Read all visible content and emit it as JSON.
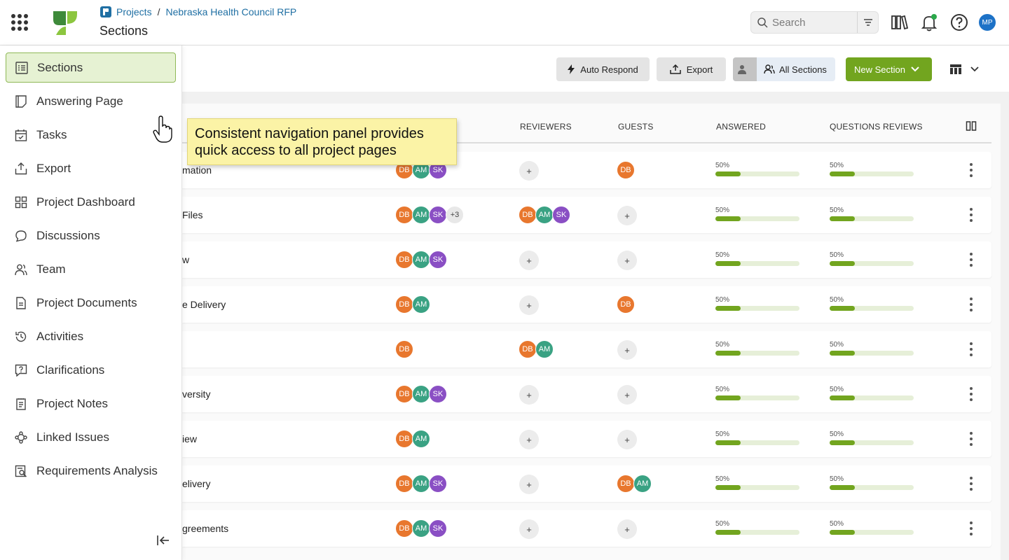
{
  "topbar": {
    "breadcrumb_projects": "Projects",
    "breadcrumb_separator": "/",
    "breadcrumb_project": "Nebraska Health Council RFP",
    "title": "Sections",
    "search_placeholder": "Search",
    "user_initials": "MP"
  },
  "toolbar": {
    "auto_respond": "Auto Respond",
    "export": "Export",
    "all_sections": "All Sections",
    "new_section": "New Section"
  },
  "table": {
    "headers": [
      "REVIEWERS",
      "GUESTS",
      "ANSWERED",
      "QUESTIONS REVIEWS"
    ],
    "rows": [
      {
        "name": "mation",
        "assignees": [
          "DB",
          "AM",
          "SK"
        ],
        "more": "",
        "reviewers": [],
        "guests": [
          "DB"
        ],
        "answered_pct": "50%",
        "answered": 0.3,
        "reviews_pct": "50%",
        "reviews": 0.3
      },
      {
        "name": "Files",
        "assignees": [
          "DB",
          "AM",
          "SK"
        ],
        "more": "+3",
        "reviewers": [
          "DB",
          "AM",
          "SK"
        ],
        "guests": [],
        "answered_pct": "50%",
        "answered": 0.3,
        "reviews_pct": "50%",
        "reviews": 0.3
      },
      {
        "name": "w",
        "assignees": [
          "DB",
          "AM",
          "SK"
        ],
        "more": "",
        "reviewers": [],
        "guests": [],
        "answered_pct": "50%",
        "answered": 0.3,
        "reviews_pct": "50%",
        "reviews": 0.3
      },
      {
        "name": "e Delivery",
        "assignees": [
          "DB",
          "AM"
        ],
        "more": "",
        "reviewers": [],
        "guests": [
          "DB"
        ],
        "answered_pct": "50%",
        "answered": 0.3,
        "reviews_pct": "50%",
        "reviews": 0.3
      },
      {
        "name": "",
        "assignees": [
          "DB"
        ],
        "more": "",
        "reviewers": [
          "DB",
          "AM"
        ],
        "guests": [],
        "answered_pct": "50%",
        "answered": 0.3,
        "reviews_pct": "50%",
        "reviews": 0.3
      },
      {
        "name": "versity",
        "assignees": [
          "DB",
          "AM",
          "SK"
        ],
        "more": "",
        "reviewers": [],
        "guests": [],
        "answered_pct": "50%",
        "answered": 0.3,
        "reviews_pct": "50%",
        "reviews": 0.3
      },
      {
        "name": "iew",
        "assignees": [
          "DB",
          "AM"
        ],
        "more": "",
        "reviewers": [],
        "guests": [],
        "answered_pct": "50%",
        "answered": 0.3,
        "reviews_pct": "50%",
        "reviews": 0.3
      },
      {
        "name": "elivery",
        "assignees": [
          "DB",
          "AM",
          "SK"
        ],
        "more": "",
        "reviewers": [],
        "guests": [
          "DB",
          "AM"
        ],
        "answered_pct": "50%",
        "answered": 0.3,
        "reviews_pct": "50%",
        "reviews": 0.3
      },
      {
        "name": "greements",
        "assignees": [
          "DB",
          "AM",
          "SK"
        ],
        "more": "",
        "reviewers": [],
        "guests": [],
        "answered_pct": "50%",
        "answered": 0.3,
        "reviews_pct": "50%",
        "reviews": 0.3
      }
    ],
    "add_symbol": "+"
  },
  "avatar_colors": {
    "DB": "#e8772e",
    "AM": "#3aa283",
    "SK": "#8a4fc4"
  },
  "sidebar": {
    "items": [
      {
        "label": "Sections",
        "icon": "list-icon"
      },
      {
        "label": "Answering Page",
        "icon": "notebook-icon"
      },
      {
        "label": "Tasks",
        "icon": "calendar-check-icon"
      },
      {
        "label": "Export",
        "icon": "upload-icon"
      },
      {
        "label": "Project Dashboard",
        "icon": "grid-icon"
      },
      {
        "label": "Discussions",
        "icon": "chat-icon"
      },
      {
        "label": "Team",
        "icon": "users-icon"
      },
      {
        "label": "Project Documents",
        "icon": "document-icon"
      },
      {
        "label": "Activities",
        "icon": "history-icon"
      },
      {
        "label": "Clarifications",
        "icon": "question-box-icon"
      },
      {
        "label": "Project Notes",
        "icon": "notes-icon"
      },
      {
        "label": "Linked Issues",
        "icon": "linked-icon"
      },
      {
        "label": "Requirements Analysis",
        "icon": "analysis-icon"
      }
    ]
  },
  "callout": {
    "text": "Consistent navigation panel provides quick access to all project pages"
  }
}
